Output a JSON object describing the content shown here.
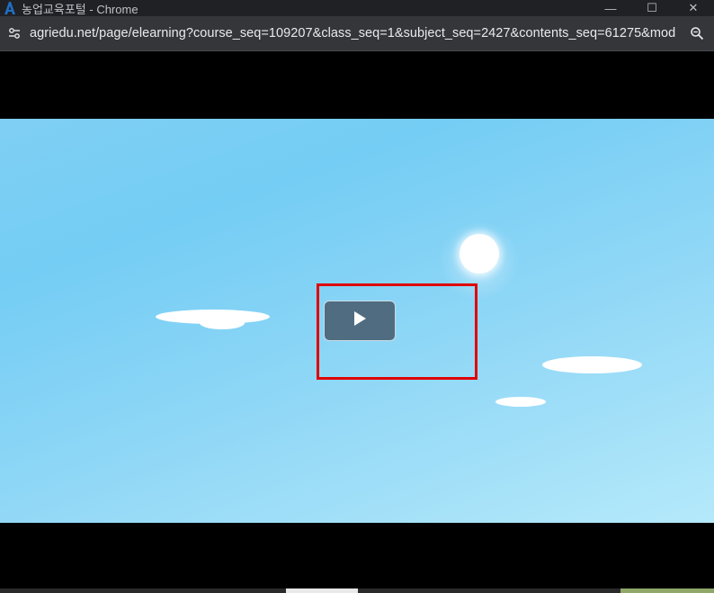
{
  "window": {
    "title": "농업교육포털 - Chrome",
    "app_icon": "agriedu-logo-icon",
    "controls": {
      "minimize": "—",
      "maximize": "☐",
      "close": "✕"
    }
  },
  "addressbar": {
    "url": "agriedu.net/page/elearning?course_seq=109207&class_seq=1&subject_seq=2427&contents_seq=61275&mode...",
    "site_info_icon": "tune-icon",
    "zoom_icon": "zoom-icon"
  },
  "video": {
    "play_icon": "play-icon"
  },
  "colors": {
    "titlebar": "#202124",
    "addressbar": "#35363a",
    "play_button": "#4f6c80",
    "highlight": "#e00000",
    "sky": "#74cdf4"
  }
}
